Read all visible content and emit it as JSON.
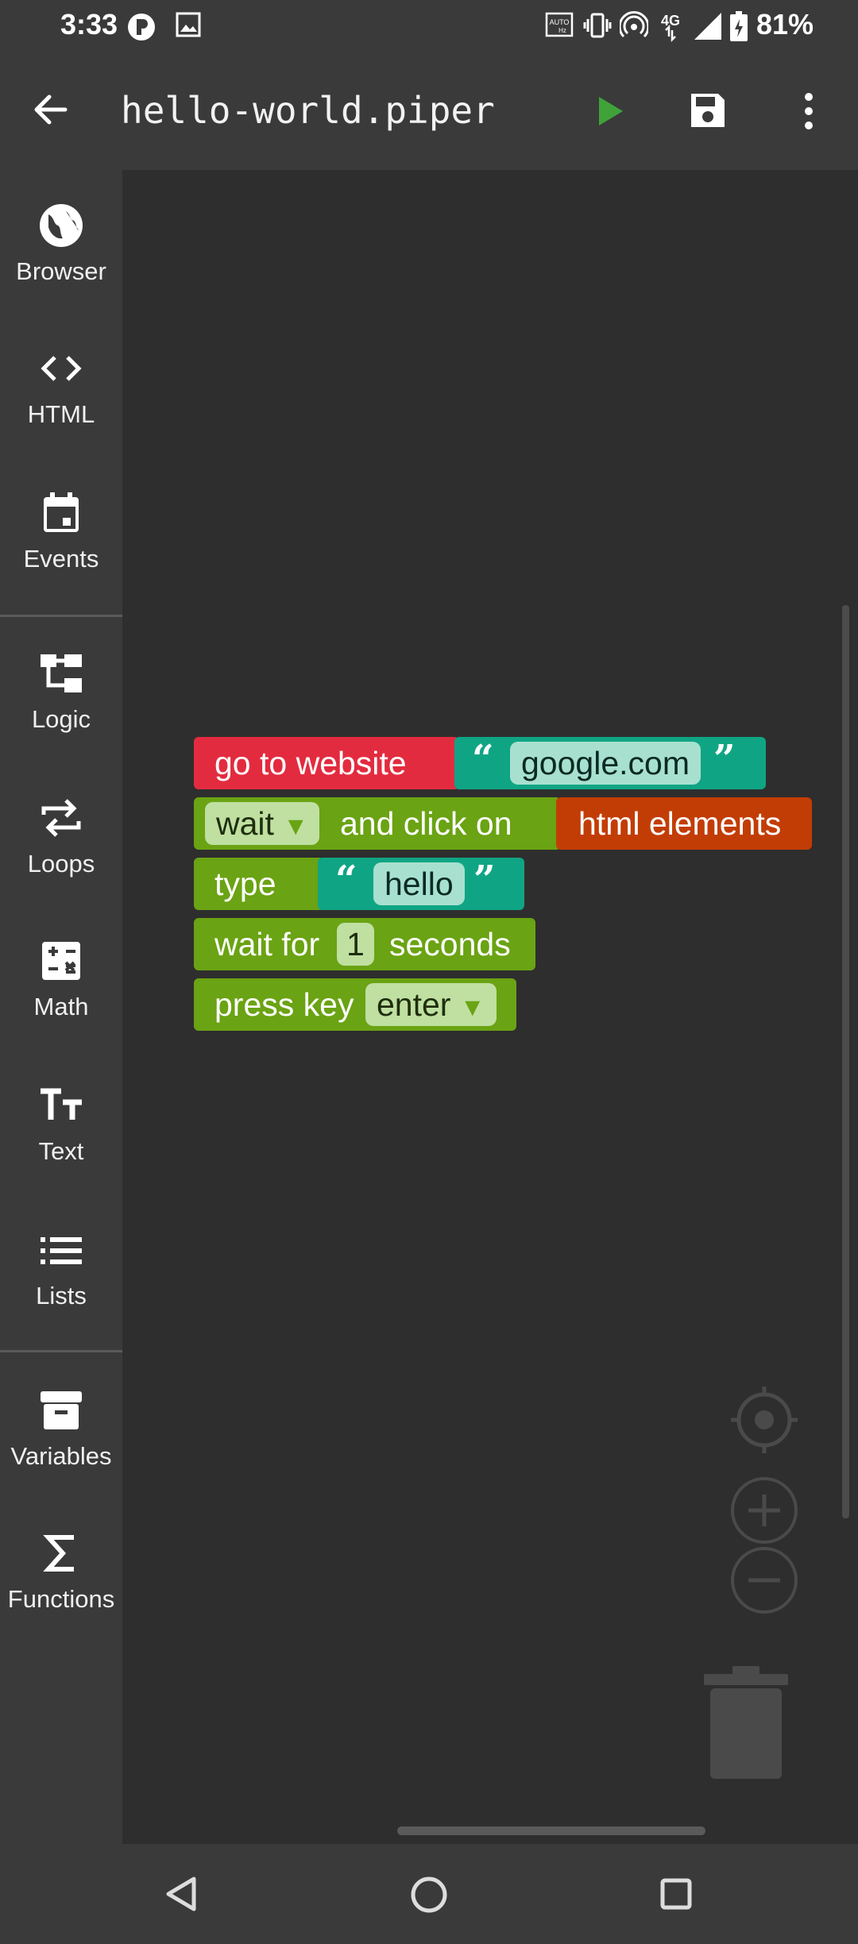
{
  "status_bar": {
    "time": "3:33",
    "battery": "81%"
  },
  "app_bar": {
    "title": "hello-world.piper"
  },
  "categories": [
    {
      "label": "Browser",
      "icon": "globe-icon"
    },
    {
      "label": "HTML",
      "icon": "code-icon"
    },
    {
      "label": "Events",
      "icon": "calendar-icon"
    },
    {
      "label": "Logic",
      "icon": "logic-tree-icon"
    },
    {
      "label": "Loops",
      "icon": "loop-arrows-icon"
    },
    {
      "label": "Math",
      "icon": "calculator-icon"
    },
    {
      "label": "Text",
      "icon": "text-size-icon"
    },
    {
      "label": "Lists",
      "icon": "list-icon"
    },
    {
      "label": "Variables",
      "icon": "archive-box-icon"
    },
    {
      "label": "Functions",
      "icon": "sigma-icon"
    }
  ],
  "blocks": {
    "go_to_website": {
      "label": "go to website",
      "url": "google.com"
    },
    "wait_click": {
      "mode": "wait",
      "label": "and click on",
      "target": "html elements"
    },
    "type": {
      "label": "type",
      "text": "hello"
    },
    "wait_for": {
      "prefix": "wait for",
      "seconds": "1",
      "suffix": "seconds"
    },
    "press_key": {
      "label": "press key",
      "key": "enter"
    }
  },
  "colors": {
    "event_red": "#e32b3f",
    "action_green": "#6aa313",
    "text_teal": "#0fa584",
    "html_orange": "#c23d05",
    "run_green": "#3fa33a"
  }
}
